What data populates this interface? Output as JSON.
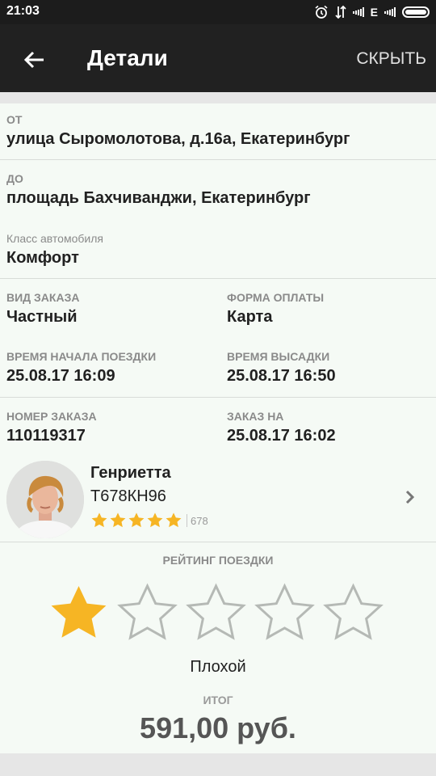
{
  "status_bar": {
    "time": "21:03",
    "network": "E"
  },
  "app_bar": {
    "title": "Детали",
    "hide_label": "СКРЫТЬ"
  },
  "route": {
    "from_label": "ОТ",
    "from_value": "улица Сыромолотова, д.16а, Екатеринбург",
    "to_label": "ДО",
    "to_value": "площадь Бахчиванджи, Екатеринбург",
    "car_class_label": "Класс автомобиля",
    "car_class_value": "Комфорт"
  },
  "order": {
    "type_label": "ВИД ЗАКАЗА",
    "type_value": "Частный",
    "payment_label": "ФОРМА ОПЛАТЫ",
    "payment_value": "Карта",
    "start_label": "ВРЕМЯ НАЧАЛА ПОЕЗДКИ",
    "start_value": "25.08.17 16:09",
    "dropoff_label": "ВРЕМЯ ВЫСАДКИ",
    "dropoff_value": "25.08.17 16:50",
    "number_label": "НОМЕР ЗАКАЗА",
    "number_value": "110119317",
    "ordered_for_label": "ЗАКАЗ НА",
    "ordered_for_value": "25.08.17 16:02"
  },
  "driver": {
    "name": "Генриетта",
    "plate": "Т678КН96",
    "stars": 5,
    "rating_count": "678",
    "star_color": "#f6b524"
  },
  "trip_rating": {
    "title": "РЕЙТИНГ ПОЕЗДКИ",
    "selected": 1,
    "max": 5,
    "label": "Плохой",
    "filled_color": "#f6b524",
    "empty_color": "#b5b9b5"
  },
  "total": {
    "label": "ИТОГ",
    "value": "591,00 руб."
  }
}
